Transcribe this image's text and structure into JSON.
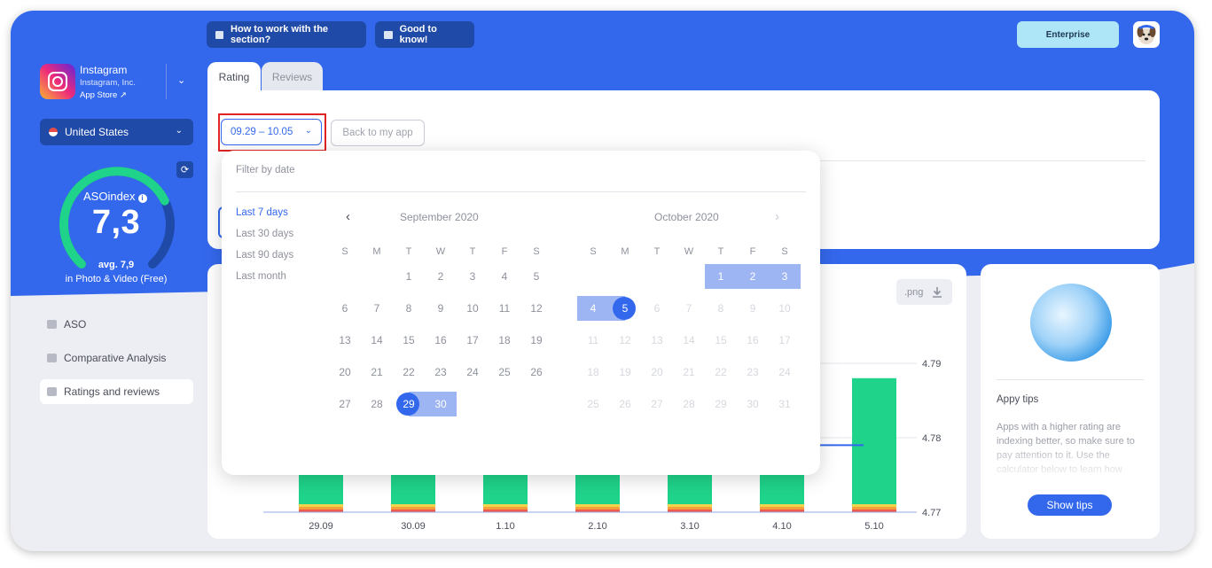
{
  "top_bar": {
    "how_to_work_label": "How to work with the section?",
    "good_to_know_label": "Good to know!",
    "enterprise_label": "Enterprise"
  },
  "app": {
    "name": "Instagram",
    "developer": "Instagram, Inc.",
    "store": "App Store"
  },
  "country": "United States",
  "aso": {
    "label": "ASOindex",
    "value": "7,3",
    "avg": "avg. 7,9",
    "category": "in Photo & Video (Free)",
    "level": 0.73
  },
  "sidebar": {
    "items": [
      {
        "label": "ASO"
      },
      {
        "label": "Comparative Analysis"
      },
      {
        "label": "Ratings and reviews"
      }
    ]
  },
  "tabs": [
    {
      "label": "Rating"
    },
    {
      "label": "Reviews"
    }
  ],
  "filters": {
    "date_range": "09.29 – 10.05",
    "back_label": "Back to my app"
  },
  "dropdown": {
    "title": "Filter by date",
    "presets": [
      "Last 7 days",
      "Last 30 days",
      "Last 90 days",
      "Last month"
    ],
    "weekday_labels": [
      "S",
      "M",
      "T",
      "W",
      "T",
      "F",
      "S"
    ],
    "months": [
      {
        "title": "September 2020",
        "start_weekday": 2,
        "days": 30
      },
      {
        "title": "October 2020",
        "start_weekday": 4,
        "days": 31
      }
    ],
    "range": {
      "start": "2020-09-29",
      "end": "2020-10-05"
    }
  },
  "chart": {
    "png_label": ".png"
  },
  "chart_data": {
    "type": "bar",
    "categories": [
      "29.09",
      "30.09",
      "1.10",
      "2.10",
      "3.10",
      "4.10",
      "5.10"
    ],
    "right_axis_ticks": [
      "4.79",
      "4.78",
      "4.77"
    ],
    "ylim": [
      4.77,
      4.79
    ],
    "visible_bar_top_value": 4.788,
    "rating_line_value": 4.779
  },
  "tips": {
    "title": "Appy tips",
    "body": "Apps with a higher rating are indexing better, so make sure to pay attention to it. Use the calculator below to learn how",
    "button": "Show tips"
  },
  "colors": {
    "brand_blue": "#3468ec",
    "bar_green": "#1fd38a",
    "enterprise": "#aee6f7"
  }
}
